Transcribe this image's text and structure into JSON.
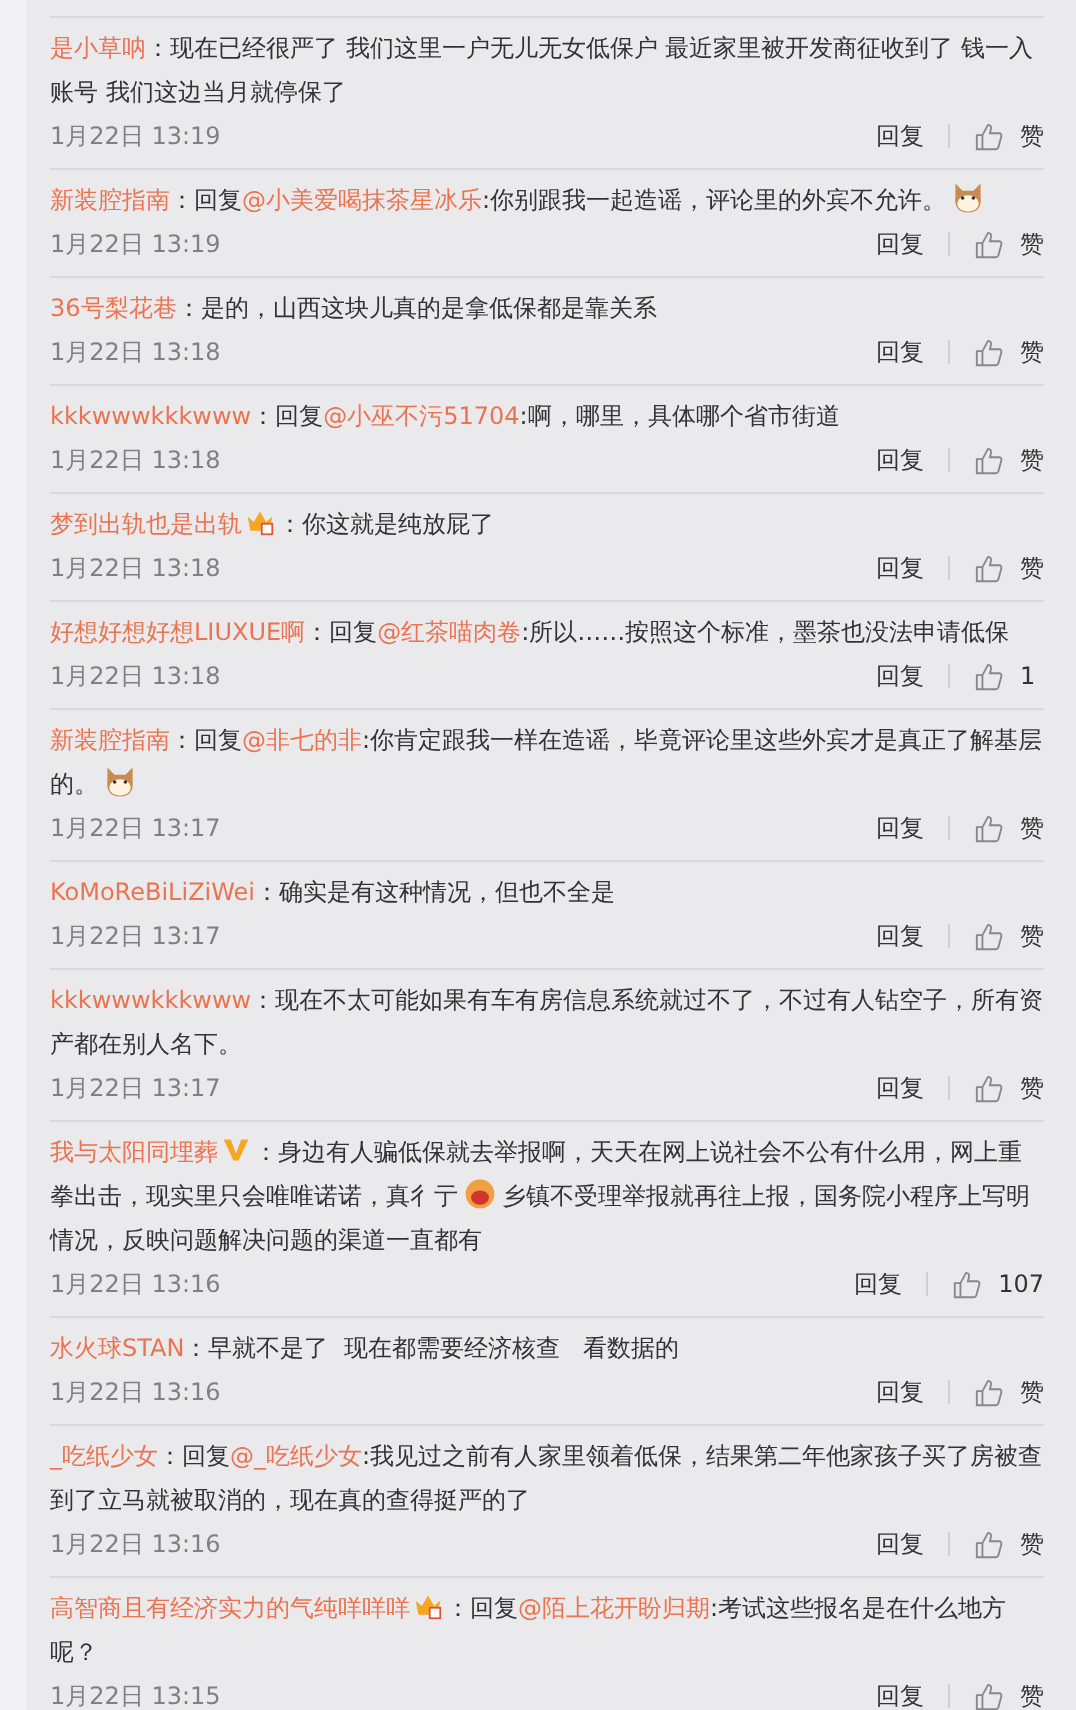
{
  "comments": [
    {
      "parts": [
        {
          "kind": "user",
          "text": "是小草呐"
        },
        {
          "kind": "text",
          "text": "：现在已经很严了 我们这里一户无儿无女低保户 最近家里被开发商征收到了 钱一入账号 我们这边当月就停保了"
        }
      ],
      "time": "1月22日 13:19",
      "reply": "回复",
      "like": "赞"
    },
    {
      "parts": [
        {
          "kind": "user",
          "text": "新装腔指南"
        },
        {
          "kind": "text",
          "text": "：回复"
        },
        {
          "kind": "mention",
          "text": "@小美爱喝抹茶星冰乐"
        },
        {
          "kind": "text",
          "text": ":你别跟我一起造谣，评论里的外宾不允许。"
        },
        {
          "kind": "cat"
        }
      ],
      "time": "1月22日 13:19",
      "reply": "回复",
      "like": "赞"
    },
    {
      "parts": [
        {
          "kind": "user",
          "text": "36号梨花巷"
        },
        {
          "kind": "text",
          "text": "：是的，山西这块儿真的是拿低保都是靠关系"
        }
      ],
      "time": "1月22日 13:18",
      "reply": "回复",
      "like": "赞"
    },
    {
      "parts": [
        {
          "kind": "user",
          "text": "kkkwwwkkkwww"
        },
        {
          "kind": "text",
          "text": "：回复"
        },
        {
          "kind": "mention",
          "text": "@小巫不污51704"
        },
        {
          "kind": "text",
          "text": ":啊，哪里，具体哪个省市街道"
        }
      ],
      "time": "1月22日 13:18",
      "reply": "回复",
      "like": "赞"
    },
    {
      "parts": [
        {
          "kind": "user",
          "text": "梦到出轨也是出轨"
        },
        {
          "kind": "crown"
        },
        {
          "kind": "text",
          "text": "：你这就是纯放屁了"
        }
      ],
      "time": "1月22日 13:18",
      "reply": "回复",
      "like": "赞"
    },
    {
      "parts": [
        {
          "kind": "user",
          "text": "好想好想好想LIUXUE啊"
        },
        {
          "kind": "text",
          "text": "：回复"
        },
        {
          "kind": "mention",
          "text": "@红茶喵肉卷"
        },
        {
          "kind": "text",
          "text": ":所以……按照这个标准，墨茶也没法申请低保"
        }
      ],
      "time": "1月22日 13:18",
      "reply": "回复",
      "like": "1"
    },
    {
      "parts": [
        {
          "kind": "user",
          "text": "新装腔指南"
        },
        {
          "kind": "text",
          "text": "：回复"
        },
        {
          "kind": "mention",
          "text": "@非七的非"
        },
        {
          "kind": "text",
          "text": ":你肯定跟我一样在造谣，毕竟评论里这些外宾才是真正了解基层的。"
        },
        {
          "kind": "cat"
        }
      ],
      "time": "1月22日 13:17",
      "reply": "回复",
      "like": "赞"
    },
    {
      "parts": [
        {
          "kind": "user",
          "text": "KoMoReBiLiZiWei"
        },
        {
          "kind": "text",
          "text": "：确实是有这种情况，但也不全是"
        }
      ],
      "time": "1月22日 13:17",
      "reply": "回复",
      "like": "赞"
    },
    {
      "parts": [
        {
          "kind": "user",
          "text": "kkkwwwkkkwww"
        },
        {
          "kind": "text",
          "text": "：现在不太可能如果有车有房信息系统就过不了，不过有人钻空子，所有资产都在别人名下。"
        }
      ],
      "time": "1月22日 13:17",
      "reply": "回复",
      "like": "赞"
    },
    {
      "parts": [
        {
          "kind": "user",
          "text": "我与太阳同埋葬"
        },
        {
          "kind": "verified"
        },
        {
          "kind": "text",
          "text": "：身边有人骗低保就去举报啊，天天在网上说社会不公有什么用，网上重拳出击，现实里只会唯唯诺诺，真彳亍"
        },
        {
          "kind": "laugh"
        },
        {
          "kind": "text",
          "text": "乡镇不受理举报就再往上报，国务院小程序上写明情况，反映问题解决问题的渠道一直都有"
        }
      ],
      "time": "1月22日 13:16",
      "reply": "回复",
      "like": "107"
    },
    {
      "parts": [
        {
          "kind": "user",
          "text": "水火球STAN"
        },
        {
          "kind": "text",
          "text": "：早就不是了  现在都需要经济核查   看数据的"
        }
      ],
      "time": "1月22日 13:16",
      "reply": "回复",
      "like": "赞"
    },
    {
      "parts": [
        {
          "kind": "user",
          "text": "_吃纸少女"
        },
        {
          "kind": "text",
          "text": "：回复"
        },
        {
          "kind": "mention",
          "text": "@_吃纸少女"
        },
        {
          "kind": "text",
          "text": ":我见过之前有人家里领着低保，结果第二年他家孩子买了房被查到了立马就被取消的，现在真的查得挺严的了"
        }
      ],
      "time": "1月22日 13:16",
      "reply": "回复",
      "like": "赞"
    },
    {
      "parts": [
        {
          "kind": "user",
          "text": "高智商且有经济实力的气纯咩咩咩"
        },
        {
          "kind": "crown"
        },
        {
          "kind": "text",
          "text": "：回复"
        },
        {
          "kind": "mention",
          "text": "@陌上花开盼归期"
        },
        {
          "kind": "text",
          "text": ":考试这些报名是在什么地方呢？"
        }
      ],
      "time": "1月22日 13:15",
      "reply": "回复",
      "like": "赞"
    }
  ]
}
